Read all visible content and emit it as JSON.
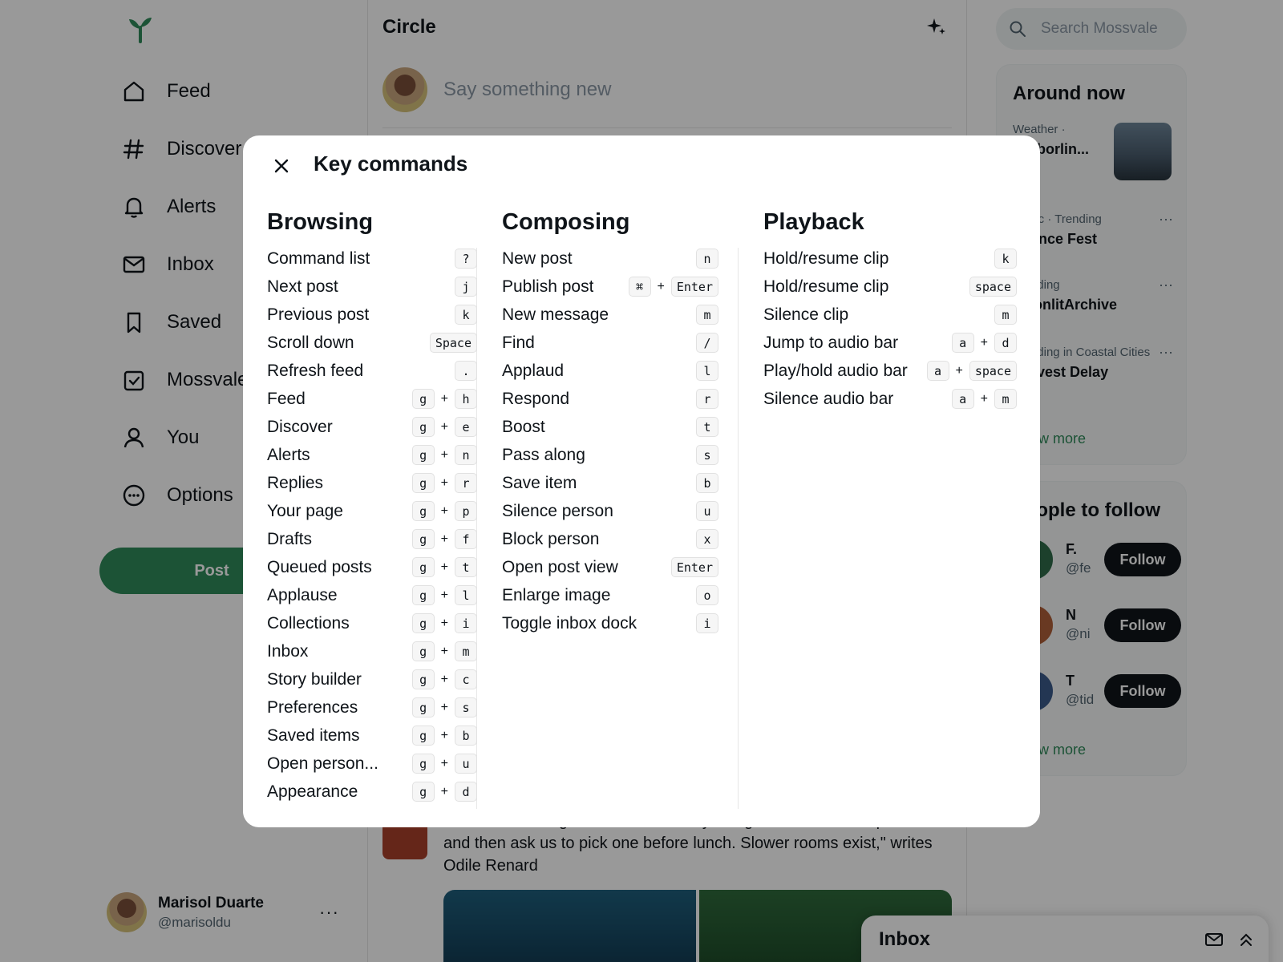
{
  "sidebar": {
    "nav": [
      {
        "label": "Feed",
        "icon": "home-icon"
      },
      {
        "label": "Discover",
        "icon": "hash-icon"
      },
      {
        "label": "Alerts",
        "icon": "bell-icon"
      },
      {
        "label": "Inbox",
        "icon": "mail-icon"
      },
      {
        "label": "Saved",
        "icon": "bookmark-icon"
      },
      {
        "label": "Mossvale",
        "icon": "checkbox-icon"
      },
      {
        "label": "You",
        "icon": "user-icon"
      },
      {
        "label": "Options",
        "icon": "options-icon"
      }
    ],
    "post_label": "Post",
    "account": {
      "name": "Marisol Duarte",
      "handle": "@marisoldu",
      "more": "···"
    }
  },
  "center": {
    "title": "Circle",
    "composer_placeholder": "Say something new",
    "feed_text": "\"The tools we argue with flatten every disagreement into two positions and then ask us to pick one before lunch. Slower rooms exist,\" writes Odile Renard"
  },
  "right": {
    "search_placeholder": "Search Mossvale",
    "around": {
      "title": "Around now",
      "trends": [
        {
          "meta": "Weather ·",
          "name": "Harborlin..."
        },
        {
          "meta": "Music · Trending",
          "name": "Silence Fest"
        },
        {
          "meta": "Trending",
          "name": "MoonlitArchive"
        },
        {
          "meta": "Trending in Coastal Cities",
          "name": "Harvest Delay"
        }
      ],
      "show_more": "Show more"
    },
    "people": {
      "title": "People to follow",
      "list": [
        {
          "name": "F.",
          "handle": "@fe",
          "follow": "Follow"
        },
        {
          "name": "N",
          "handle": "@ni",
          "follow": "Follow"
        },
        {
          "name": "T",
          "handle": "@tid",
          "follow": "Follow"
        }
      ],
      "show_more": "Show more"
    }
  },
  "inbox_dock": {
    "title": "Inbox"
  },
  "modal": {
    "title": "Key commands",
    "sections": [
      {
        "title": "Browsing",
        "rows": [
          {
            "label": "Command list",
            "keys": [
              "?"
            ]
          },
          {
            "label": "Next post",
            "keys": [
              "j"
            ]
          },
          {
            "label": "Previous post",
            "keys": [
              "k"
            ]
          },
          {
            "label": "Scroll down",
            "keys": [
              "Space"
            ]
          },
          {
            "label": "Refresh feed",
            "keys": [
              "."
            ]
          },
          {
            "label": "Feed",
            "keys": [
              "g",
              "h"
            ]
          },
          {
            "label": "Discover",
            "keys": [
              "g",
              "e"
            ]
          },
          {
            "label": "Alerts",
            "keys": [
              "g",
              "n"
            ]
          },
          {
            "label": "Replies",
            "keys": [
              "g",
              "r"
            ]
          },
          {
            "label": "Your page",
            "keys": [
              "g",
              "p"
            ]
          },
          {
            "label": "Drafts",
            "keys": [
              "g",
              "f"
            ]
          },
          {
            "label": "Queued posts",
            "keys": [
              "g",
              "t"
            ]
          },
          {
            "label": "Applause",
            "keys": [
              "g",
              "l"
            ]
          },
          {
            "label": "Collections",
            "keys": [
              "g",
              "i"
            ]
          },
          {
            "label": "Inbox",
            "keys": [
              "g",
              "m"
            ]
          },
          {
            "label": "Story builder",
            "keys": [
              "g",
              "c"
            ]
          },
          {
            "label": "Preferences",
            "keys": [
              "g",
              "s"
            ]
          },
          {
            "label": "Saved items",
            "keys": [
              "g",
              "b"
            ]
          },
          {
            "label": "Open person...",
            "keys": [
              "g",
              "u"
            ]
          },
          {
            "label": "Appearance",
            "keys": [
              "g",
              "d"
            ]
          }
        ]
      },
      {
        "title": "Composing",
        "rows": [
          {
            "label": "New post",
            "keys": [
              "n"
            ]
          },
          {
            "label": "Publish post",
            "keys": [
              "⌘",
              "Enter"
            ]
          },
          {
            "label": "New message",
            "keys": [
              "m"
            ]
          },
          {
            "label": "Find",
            "keys": [
              "/"
            ]
          },
          {
            "label": "Applaud",
            "keys": [
              "l"
            ]
          },
          {
            "label": "Respond",
            "keys": [
              "r"
            ]
          },
          {
            "label": "Boost",
            "keys": [
              "t"
            ]
          },
          {
            "label": "Pass along",
            "keys": [
              "s"
            ]
          },
          {
            "label": "Save item",
            "keys": [
              "b"
            ]
          },
          {
            "label": "Silence person",
            "keys": [
              "u"
            ]
          },
          {
            "label": "Block person",
            "keys": [
              "x"
            ]
          },
          {
            "label": "Open post view",
            "keys": [
              "Enter"
            ]
          },
          {
            "label": "Enlarge image",
            "keys": [
              "o"
            ]
          },
          {
            "label": "Toggle inbox dock",
            "keys": [
              "i"
            ]
          }
        ]
      },
      {
        "title": "Playback",
        "rows": [
          {
            "label": "Hold/resume clip",
            "keys": [
              "k"
            ]
          },
          {
            "label": "Hold/resume clip",
            "keys": [
              "space"
            ]
          },
          {
            "label": "Silence clip",
            "keys": [
              "m"
            ]
          },
          {
            "label": "Jump to audio bar",
            "keys": [
              "a",
              "d"
            ]
          },
          {
            "label": "Play/hold audio bar",
            "keys": [
              "a",
              "space"
            ]
          },
          {
            "label": "Silence audio bar",
            "keys": [
              "a",
              "m"
            ]
          }
        ]
      }
    ]
  },
  "colors": {
    "accent": "#2f8a5a",
    "follow": "#0f1419",
    "overlay": "rgba(0,0,0,0.40)"
  }
}
